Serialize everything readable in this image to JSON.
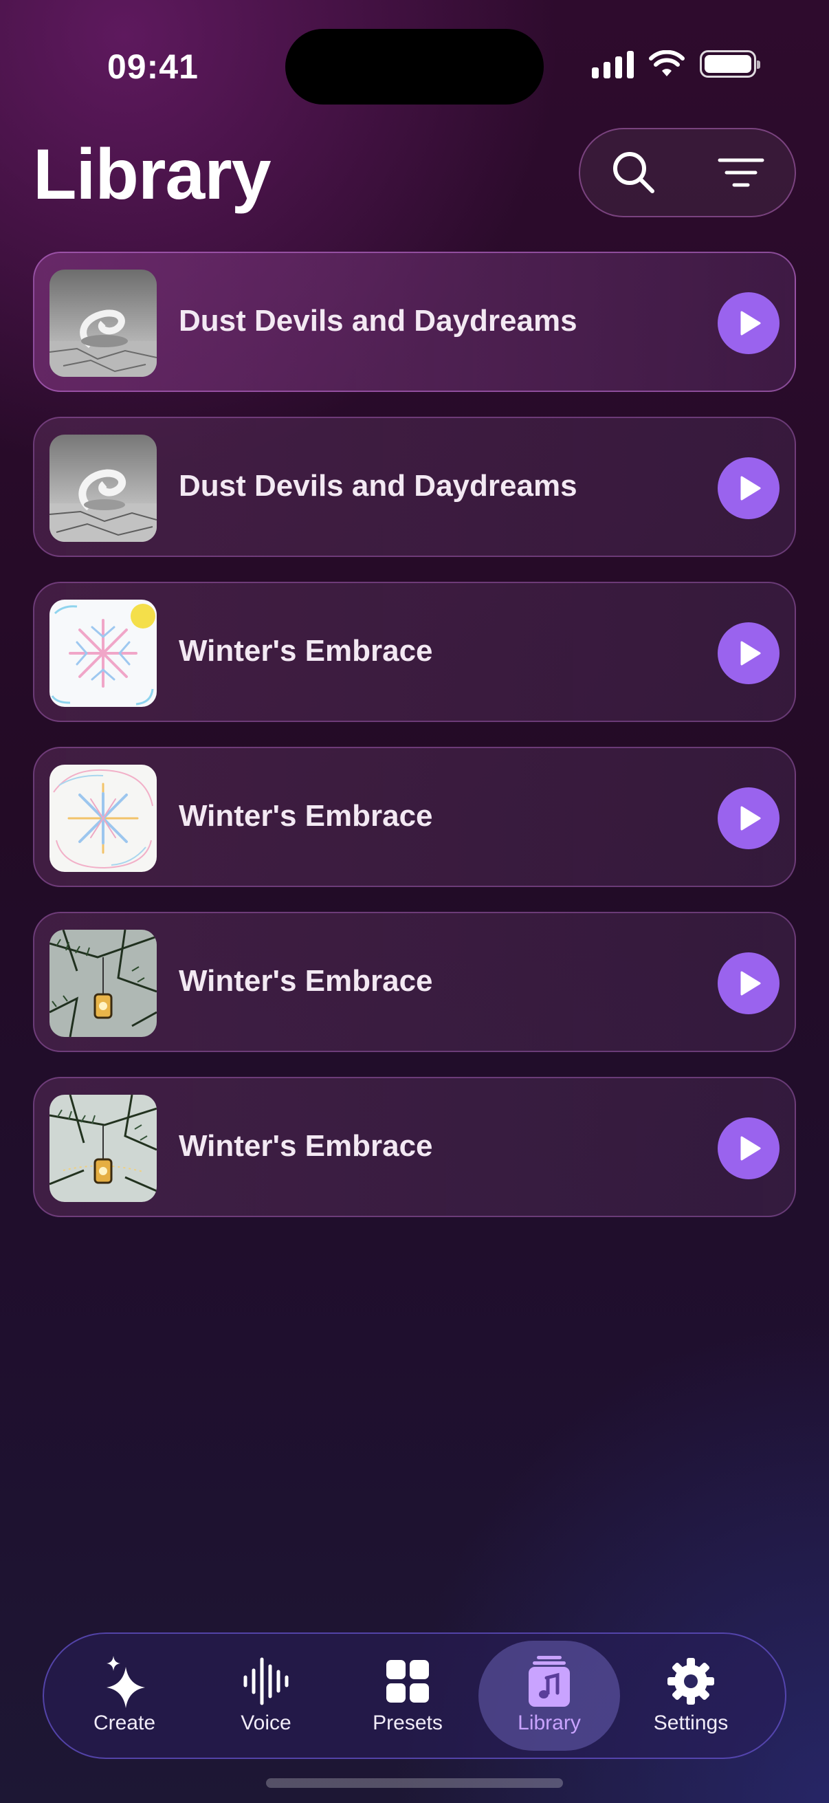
{
  "status_bar": {
    "time": "09:41"
  },
  "header": {
    "title": "Library",
    "search_icon": "search-icon",
    "filter_icon": "filter-icon"
  },
  "tracks": [
    {
      "title": "Dust Devils and Daydreams",
      "artwork": "dust-devil"
    },
    {
      "title": "Dust Devils and Daydreams",
      "artwork": "dust-devil"
    },
    {
      "title": "Winter's Embrace",
      "artwork": "snowflake-sun"
    },
    {
      "title": "Winter's Embrace",
      "artwork": "snowflake"
    },
    {
      "title": "Winter's Embrace",
      "artwork": "lantern-pine"
    },
    {
      "title": "Winter's Embrace",
      "artwork": "lantern-pine"
    }
  ],
  "tab_bar": {
    "tabs": [
      {
        "label": "Create",
        "icon": "sparkle-icon"
      },
      {
        "label": "Voice",
        "icon": "waveform-icon"
      },
      {
        "label": "Presets",
        "icon": "grid-icon"
      },
      {
        "label": "Library",
        "icon": "music-library-icon",
        "active": true
      },
      {
        "label": "Settings",
        "icon": "gear-icon"
      }
    ]
  },
  "colors": {
    "accent": "#9a63ee",
    "active_tab_label": "#c9a3ff"
  }
}
